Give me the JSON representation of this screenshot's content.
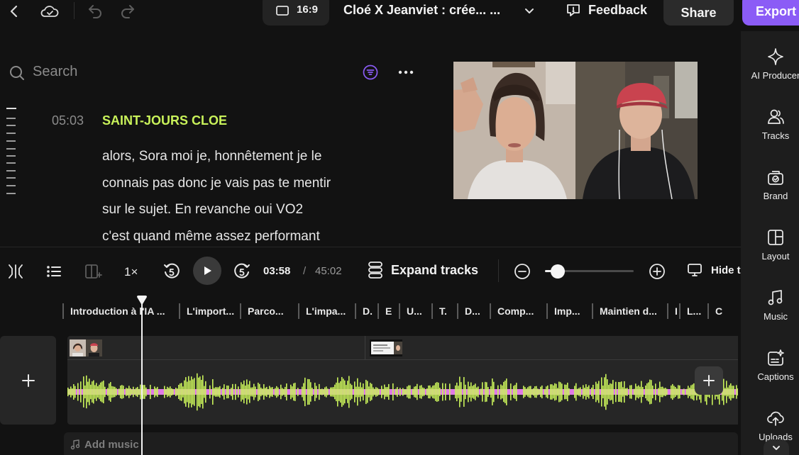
{
  "topbar": {
    "aspect_ratio": "16:9",
    "project_title": "Cloé X Jeanviet : crée... ...",
    "feedback_label": "Feedback",
    "share_label": "Share",
    "export_label": "Export"
  },
  "transcript": {
    "search_placeholder": "Search",
    "timestamp": "05:03",
    "speaker": "SAINT-JOURS CLOE",
    "lines": [
      "alors, Sora moi je, honnêtement je le",
      "connais pas donc je vais pas te mentir",
      "sur le sujet. En revanche oui VO2",
      "c'est quand même assez performant"
    ]
  },
  "sidebar": {
    "items": [
      {
        "label": "AI Producer",
        "icon": "sparkle-icon"
      },
      {
        "label": "Tracks",
        "icon": "users-icon"
      },
      {
        "label": "Brand",
        "icon": "brand-kit-icon"
      },
      {
        "label": "Layout",
        "icon": "layout-icon"
      },
      {
        "label": "Music",
        "icon": "music-note-icon"
      },
      {
        "label": "Captions",
        "icon": "captions-icon"
      },
      {
        "label": "Uploads",
        "icon": "upload-cloud-icon"
      }
    ]
  },
  "controls": {
    "speed": "1×",
    "current_time": "03:58",
    "separator": "/",
    "total_time": "45:02",
    "expand_tracks_label": "Expand tracks",
    "hide_label": "Hide t",
    "zoom_level_fraction": 0.14
  },
  "timeline": {
    "chapters": [
      "Introduction à l'IA ...",
      "L'import...",
      "Parco...",
      "L'impa...",
      "D.",
      "E",
      "U...",
      "T.",
      "D...",
      "Comp...",
      "Imp...",
      "Maintien d...",
      "I",
      "L...",
      "C"
    ],
    "add_music_label": "Add music",
    "playhead_time": "03:58"
  },
  "colors": {
    "accent": "#8b5cf6",
    "speaker": "#c9f25a",
    "waveform_primary": "#c9f25a",
    "waveform_secondary": "#e07ae6",
    "background": "#121212"
  }
}
